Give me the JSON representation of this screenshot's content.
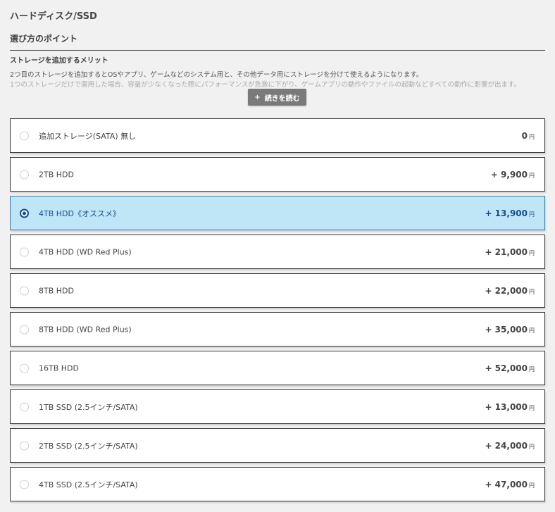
{
  "page": {
    "title": "ハードディスク/SSD",
    "section_heading": "選び方のポイント",
    "sub_heading": "ストレージを追加するメリット",
    "desc_line1": "2つ目のストレージを追加するとOSやアプリ、ゲームなどのシステム用と、その他データ用にストレージを分けて使えるようになります。",
    "desc_line2": "1つのストレージだけで運用した場合、容量が少なくなった際にパフォーマンスが急激に下がり、ゲームアプリの動作やファイルの起動などすべての動作に影響が出ます。",
    "read_more_icon": "+",
    "read_more_label": "続きを読む",
    "currency": "円"
  },
  "options": [
    {
      "label": "追加ストレージ(SATA) 無し",
      "price": "0",
      "selected": false
    },
    {
      "label": "2TB HDD",
      "price": "+ 9,900",
      "selected": false
    },
    {
      "label": "4TB HDD《オススメ》",
      "price": "+ 13,900",
      "selected": true
    },
    {
      "label": "4TB HDD (WD Red Plus)",
      "price": "+ 21,000",
      "selected": false
    },
    {
      "label": "8TB HDD",
      "price": "+ 22,000",
      "selected": false
    },
    {
      "label": "8TB HDD (WD Red Plus)",
      "price": "+ 35,000",
      "selected": false
    },
    {
      "label": "16TB HDD",
      "price": "+ 52,000",
      "selected": false
    },
    {
      "label": "1TB SSD (2.5インチ/SATA)",
      "price": "+ 13,000",
      "selected": false
    },
    {
      "label": "2TB SSD (2.5インチ/SATA)",
      "price": "+ 24,000",
      "selected": false
    },
    {
      "label": "4TB SSD (2.5インチ/SATA)",
      "price": "+ 47,000",
      "selected": false
    }
  ],
  "colors": {
    "selected_background": "#bfe6f7",
    "selected_text": "#1b4c8a",
    "button_background": "#7a7a7a"
  }
}
